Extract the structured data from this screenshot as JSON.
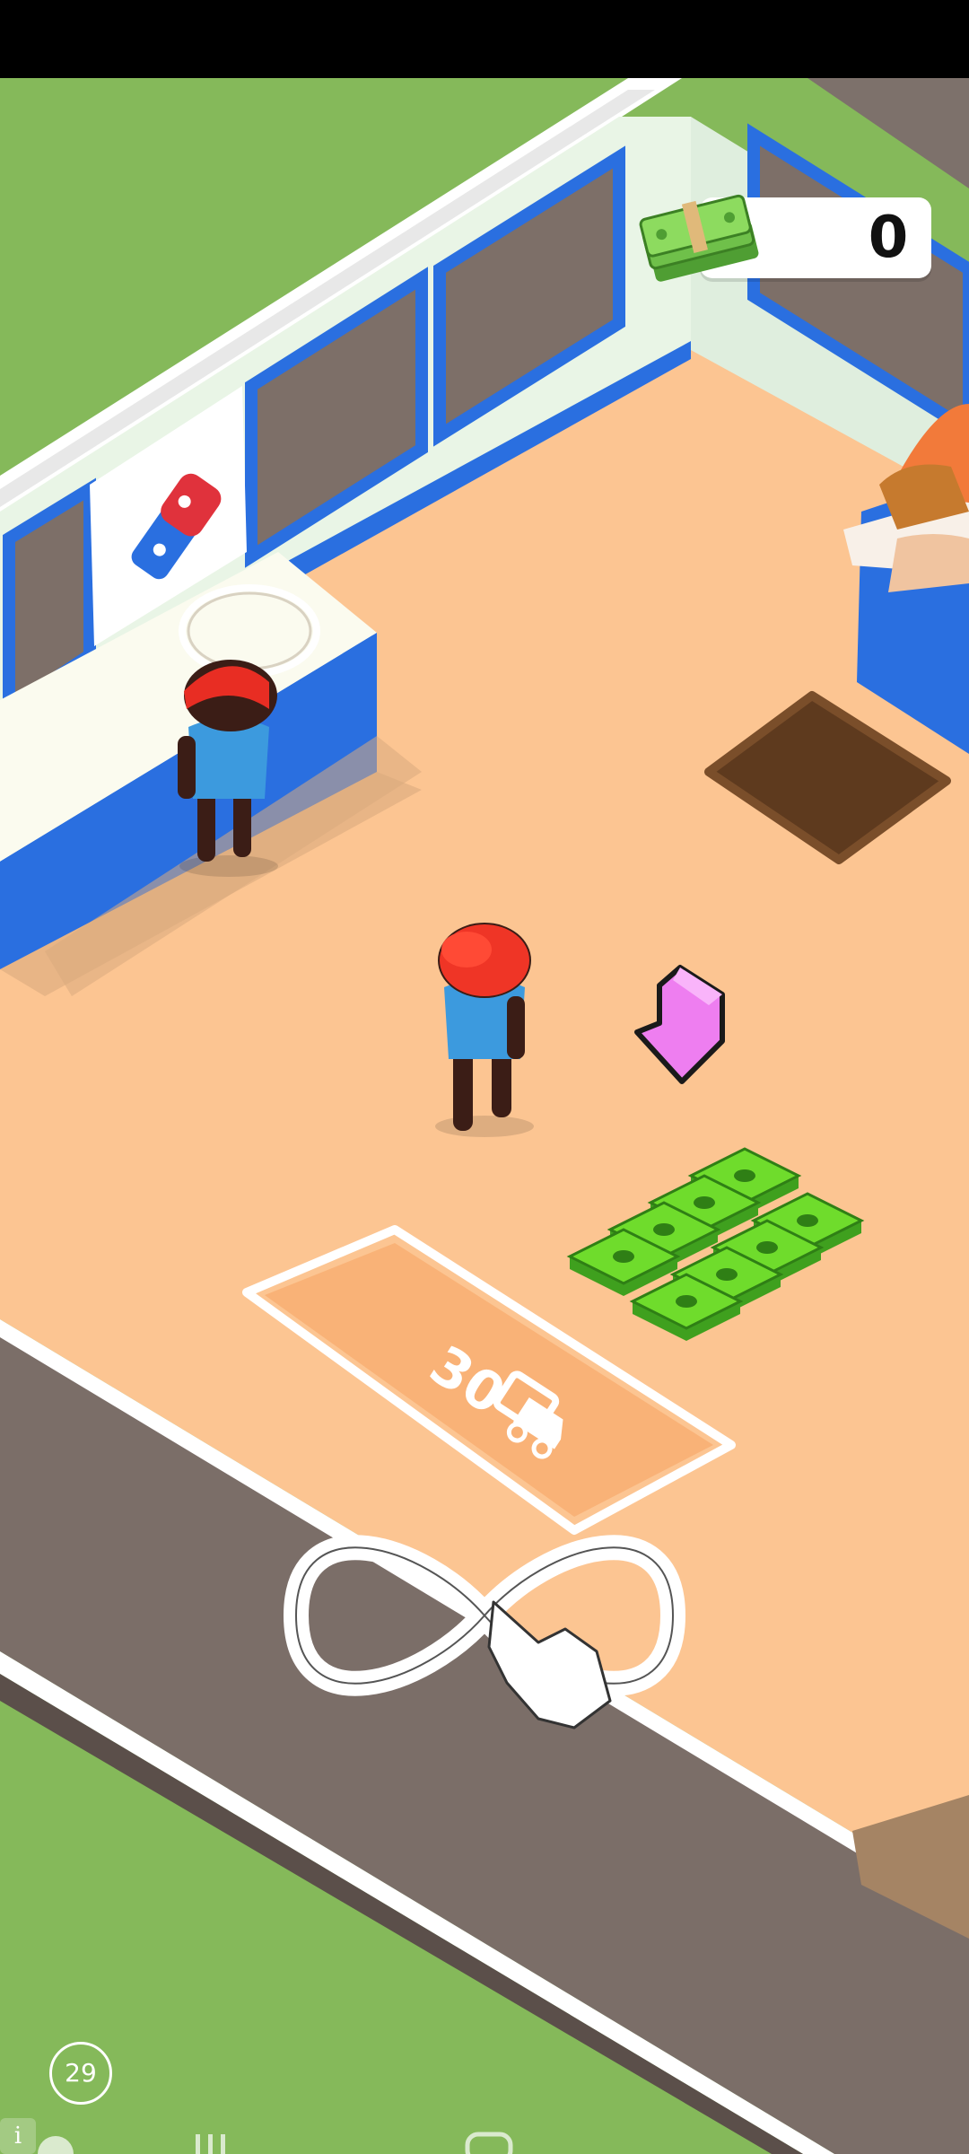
{
  "hud": {
    "cash_amount": "0",
    "cash_icon": "cash-stack-icon"
  },
  "delivery_spot": {
    "label": "30",
    "icon": "delivery-car-icon"
  },
  "tutorial": {
    "gesture": "infinity-swipe-hand-icon"
  },
  "timer": {
    "value": "29"
  },
  "store": {
    "logo": "domino-logo-icon",
    "cash_pile_count": 8,
    "colors": {
      "floor": "#fcc592",
      "wall_blue": "#2a6fe0",
      "grass": "#85b95a",
      "road": "#7b6e68",
      "cash_green": "#6fdc2c",
      "arrow_pink": "#ee7ef0"
    }
  }
}
